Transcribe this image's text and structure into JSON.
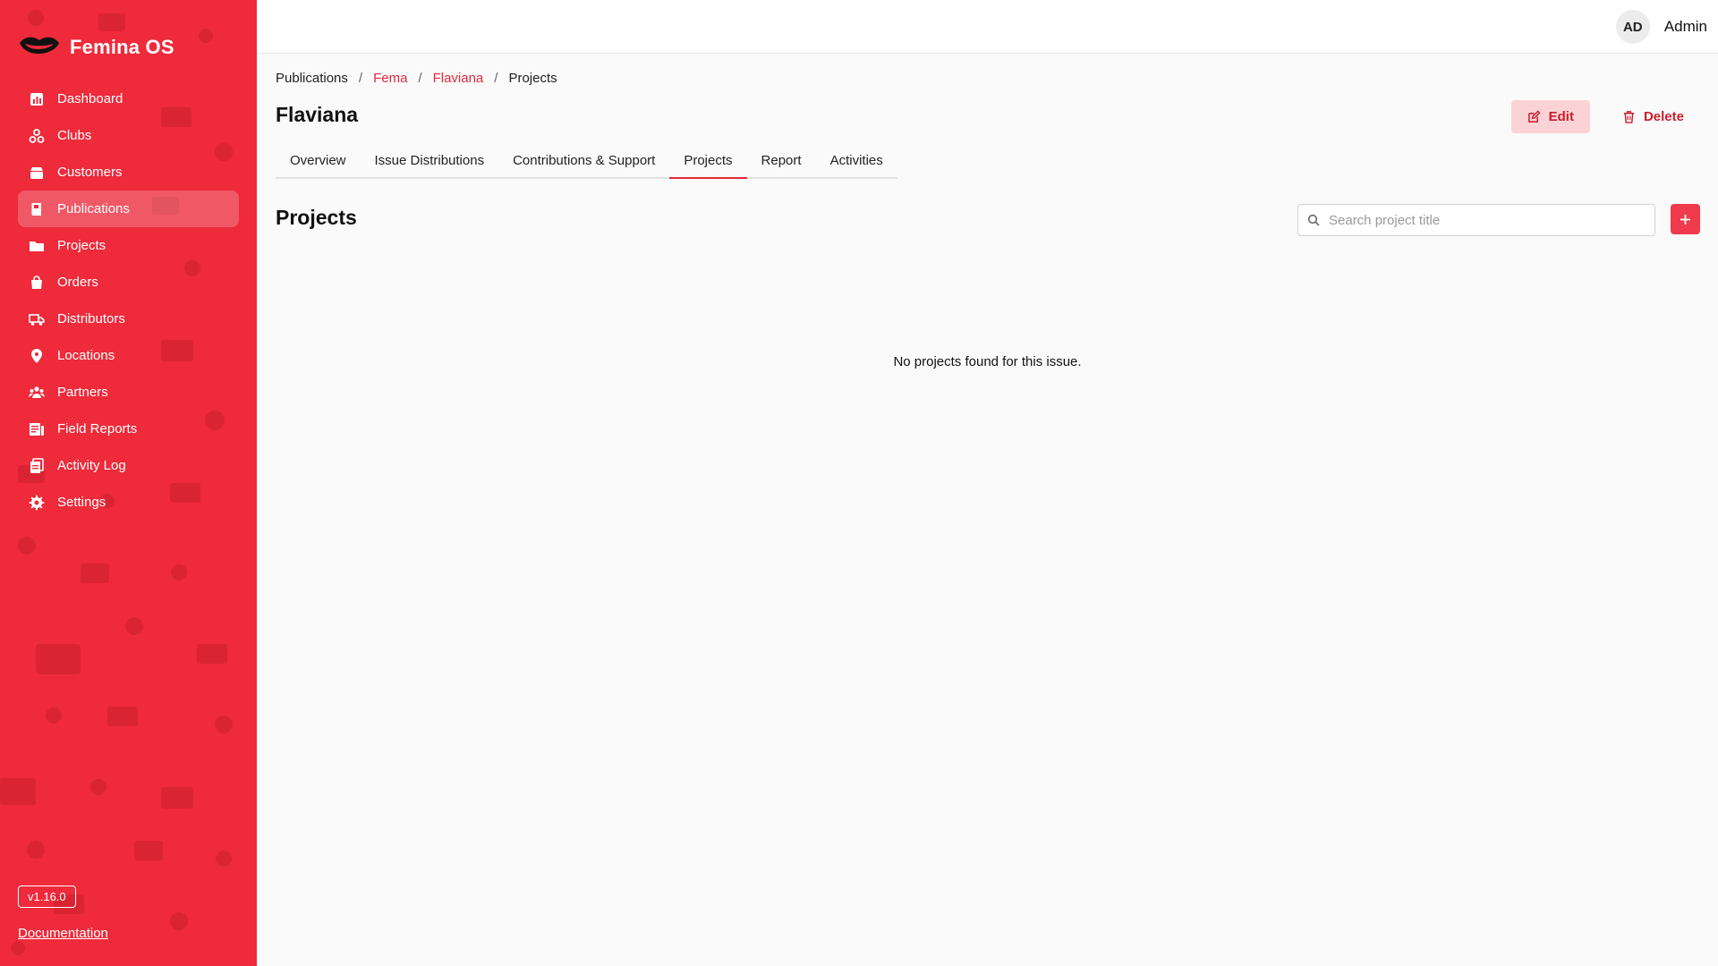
{
  "brand": {
    "name": "Femina OS"
  },
  "sidebar": {
    "items": [
      {
        "label": "Dashboard",
        "icon": "chart-icon"
      },
      {
        "label": "Clubs",
        "icon": "clubs-icon"
      },
      {
        "label": "Customers",
        "icon": "box-icon"
      },
      {
        "label": "Publications",
        "icon": "book-icon",
        "active": true
      },
      {
        "label": "Projects",
        "icon": "folder-icon"
      },
      {
        "label": "Orders",
        "icon": "shopping-bag-icon"
      },
      {
        "label": "Distributors",
        "icon": "truck-icon"
      },
      {
        "label": "Locations",
        "icon": "map-pin-icon"
      },
      {
        "label": "Partners",
        "icon": "users-icon"
      },
      {
        "label": "Field Reports",
        "icon": "report-icon"
      },
      {
        "label": "Activity Log",
        "icon": "clipboard-icon"
      },
      {
        "label": "Settings",
        "icon": "gear-icon"
      }
    ],
    "version": "v1.16.0",
    "docs": "Documentation"
  },
  "topbar": {
    "avatar": "AD",
    "username": "Admin"
  },
  "breadcrumb": {
    "items": [
      "Publications",
      "Fema",
      "Flaviana",
      "Projects"
    ],
    "separator": "/"
  },
  "page": {
    "title": "Flaviana",
    "edit_label": "Edit",
    "delete_label": "Delete"
  },
  "tabs": [
    "Overview",
    "Issue Distributions",
    "Contributions & Support",
    "Projects",
    "Report",
    "Activities"
  ],
  "active_tab": "Projects",
  "projects": {
    "title": "Projects",
    "search_placeholder": "Search project title",
    "search_value": "",
    "empty_message": "No projects found for this issue."
  },
  "colors": {
    "brand_red": "#ee2a3b",
    "accent": "#e22a3b",
    "edit_bg": "#fbd3d6",
    "add_button": "#ef3b4b"
  }
}
